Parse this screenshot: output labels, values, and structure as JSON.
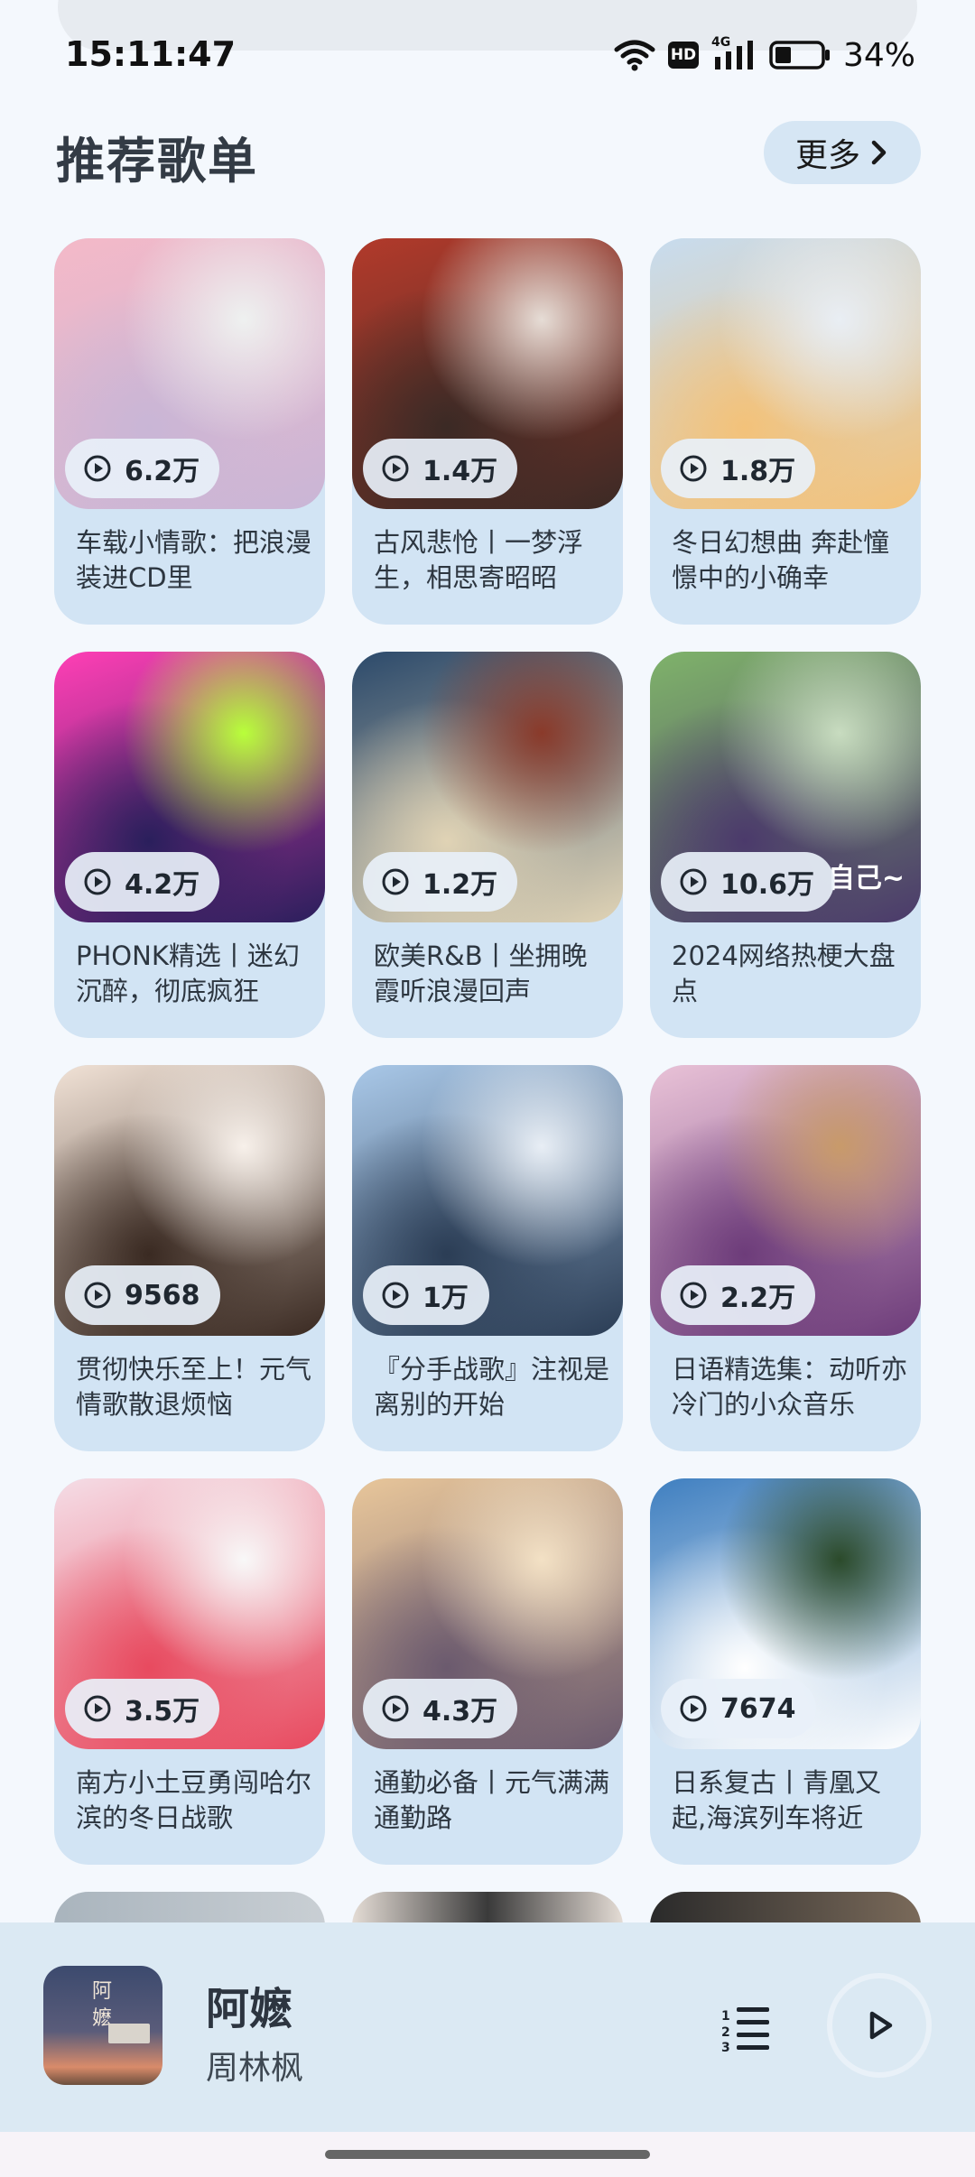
{
  "status": {
    "time": "15:11:47",
    "battery": "34%",
    "hd_label": "HD",
    "network_label": "4G"
  },
  "section": {
    "title": "推荐歌单",
    "more": "更多"
  },
  "playlists": [
    {
      "count": "6.2万",
      "title": "车载小情歌：把浪漫装进CD里",
      "colors": [
        "#f4b9c8",
        "#c9b6d6",
        "#eef1f0"
      ]
    },
    {
      "count": "1.4万",
      "title": "古风悲怆丨一梦浮生，相思寄昭昭",
      "colors": [
        "#b23a2b",
        "#3b2a25",
        "#e6ddd6"
      ]
    },
    {
      "count": "1.8万",
      "title": "冬日幻想曲 奔赴憧憬中的小确幸",
      "colors": [
        "#c7dcef",
        "#f3c27a",
        "#e9eef4"
      ]
    },
    {
      "count": "4.2万",
      "title": "PHONK精选丨迷幻沉醉，彻底疯狂",
      "colors": [
        "#ff3fb5",
        "#2a1f5c",
        "#b8ff3a"
      ]
    },
    {
      "count": "1.2万",
      "title": "欧美R&B丨坐拥晚霞听浪漫回声",
      "colors": [
        "#2c4a6b",
        "#e0d3b5",
        "#8a3a2a"
      ]
    },
    {
      "count": "10.6万",
      "title": "2024网络热梗大盘点",
      "colors": [
        "#7fb36a",
        "#4b3a6b",
        "#c8dcc0"
      ],
      "overlay": "自己~"
    },
    {
      "count": "9568",
      "title": "贯彻快乐至上！元气情歌散退烦恼",
      "colors": [
        "#f1e2d6",
        "#3a2a22",
        "#f7f0ea"
      ]
    },
    {
      "count": "1万",
      "title": "『分手战歌』注视是离别的开始",
      "colors": [
        "#a9c8e8",
        "#2b3d55",
        "#e8eef5"
      ]
    },
    {
      "count": "2.2万",
      "title": "日语精选集：动听亦冷门的小众音乐",
      "colors": [
        "#e9c2d7",
        "#6d3c7a",
        "#c89a6a"
      ]
    },
    {
      "count": "3.5万",
      "title": "南方小土豆勇闯哈尔滨的冬日战歌",
      "colors": [
        "#f5dde6",
        "#e84a5f",
        "#f8f8f8"
      ]
    },
    {
      "count": "4.3万",
      "title": "通勤必备丨元气满满通勤路",
      "colors": [
        "#e8c69a",
        "#6b5a6e",
        "#f3e1c5"
      ]
    },
    {
      "count": "7674",
      "title": "日系复古丨青凰又起,海滨列车将近",
      "colors": [
        "#3f7fc0",
        "#ffffff",
        "#2b4a2a"
      ]
    }
  ],
  "now_playing": {
    "title": "阿嬷",
    "artist": "周林枫",
    "cover_text": "阿嬷"
  },
  "icons": {
    "wifi": "wifi-icon",
    "signal": "signal-icon",
    "battery": "battery-icon",
    "more_chevron": "chevron-right-icon",
    "play_small": "play-circle-icon",
    "playlist": "playlist-icon",
    "play": "play-icon"
  }
}
